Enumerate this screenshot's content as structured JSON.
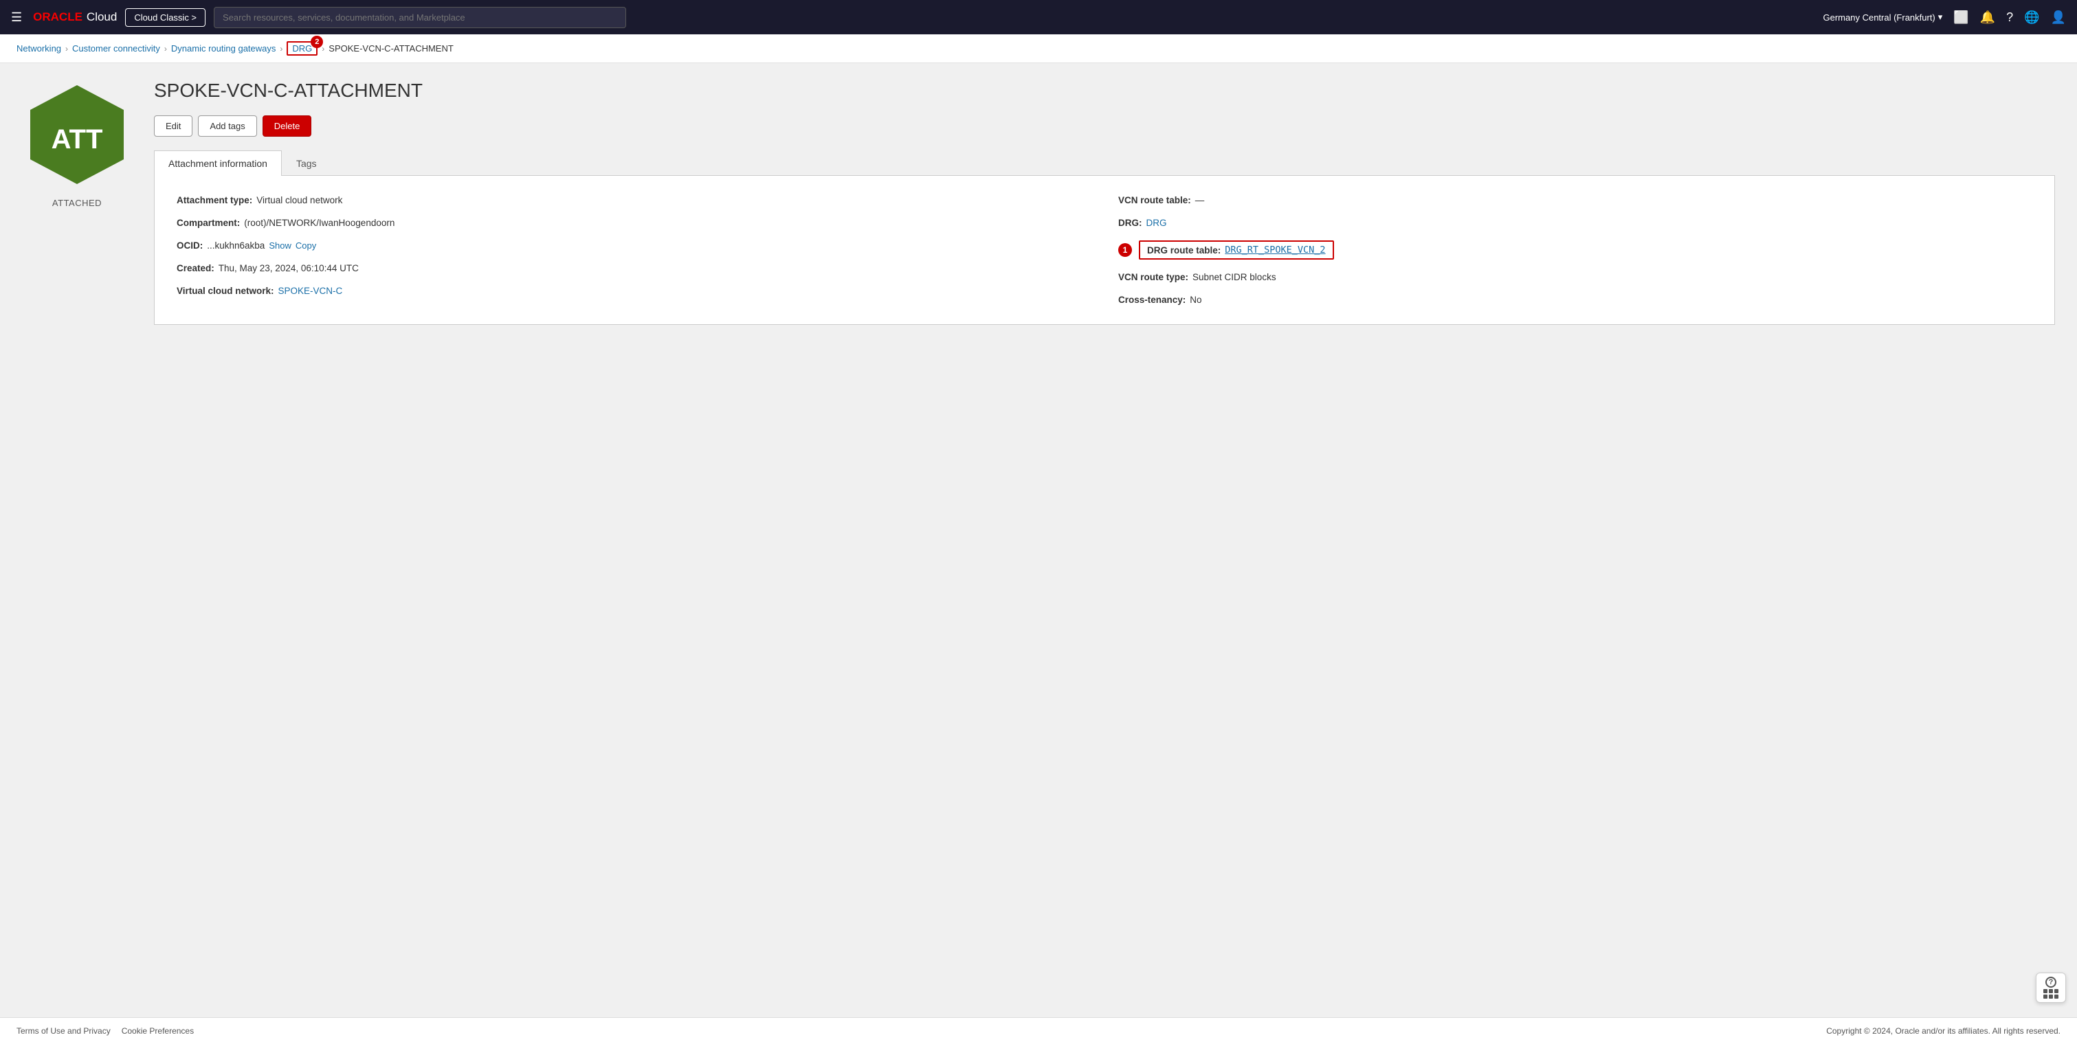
{
  "topnav": {
    "logo_oracle": "ORACLE",
    "logo_cloud": "Cloud",
    "classic_btn": "Cloud Classic >",
    "search_placeholder": "Search resources, services, documentation, and Marketplace",
    "region": "Germany Central (Frankfurt)",
    "chevron_icon": "▾"
  },
  "breadcrumb": {
    "networking": "Networking",
    "customer_connectivity": "Customer connectivity",
    "dynamic_routing_gateways": "Dynamic routing gateways",
    "drg": "DRG",
    "current": "SPOKE-VCN-C-ATTACHMENT",
    "drg_badge": "2"
  },
  "page": {
    "title": "SPOKE-VCN-C-ATTACHMENT",
    "hex_label": "ATTACHED",
    "hex_text": "ATT"
  },
  "actions": {
    "edit": "Edit",
    "add_tags": "Add tags",
    "delete": "Delete"
  },
  "tabs": [
    {
      "id": "attachment-information",
      "label": "Attachment information",
      "active": true
    },
    {
      "id": "tags",
      "label": "Tags",
      "active": false
    }
  ],
  "attachment_info": {
    "attachment_type_label": "Attachment type:",
    "attachment_type_value": "Virtual cloud network",
    "compartment_label": "Compartment:",
    "compartment_value": "(root)/NETWORK/IwanHoogendoorn",
    "ocid_label": "OCID:",
    "ocid_value": "...kukhn6akba",
    "ocid_show": "Show",
    "ocid_copy": "Copy",
    "created_label": "Created:",
    "created_value": "Thu, May 23, 2024, 06:10:44 UTC",
    "vcn_label": "Virtual cloud network:",
    "vcn_value": "SPOKE-VCN-C",
    "vcn_route_table_label": "VCN route table:",
    "vcn_route_table_value": "—",
    "drg_label": "DRG:",
    "drg_value": "DRG",
    "drg_route_table_label": "DRG route table:",
    "drg_route_table_value": "DRG_RT_SPOKE_VCN_2",
    "drg_route_badge": "1",
    "vcn_route_type_label": "VCN route type:",
    "vcn_route_type_value": "Subnet CIDR blocks",
    "cross_tenancy_label": "Cross-tenancy:",
    "cross_tenancy_value": "No"
  },
  "footer": {
    "terms": "Terms of Use and Privacy",
    "cookies": "Cookie Preferences",
    "copyright": "Copyright © 2024, Oracle and/or its affiliates. All rights reserved."
  }
}
